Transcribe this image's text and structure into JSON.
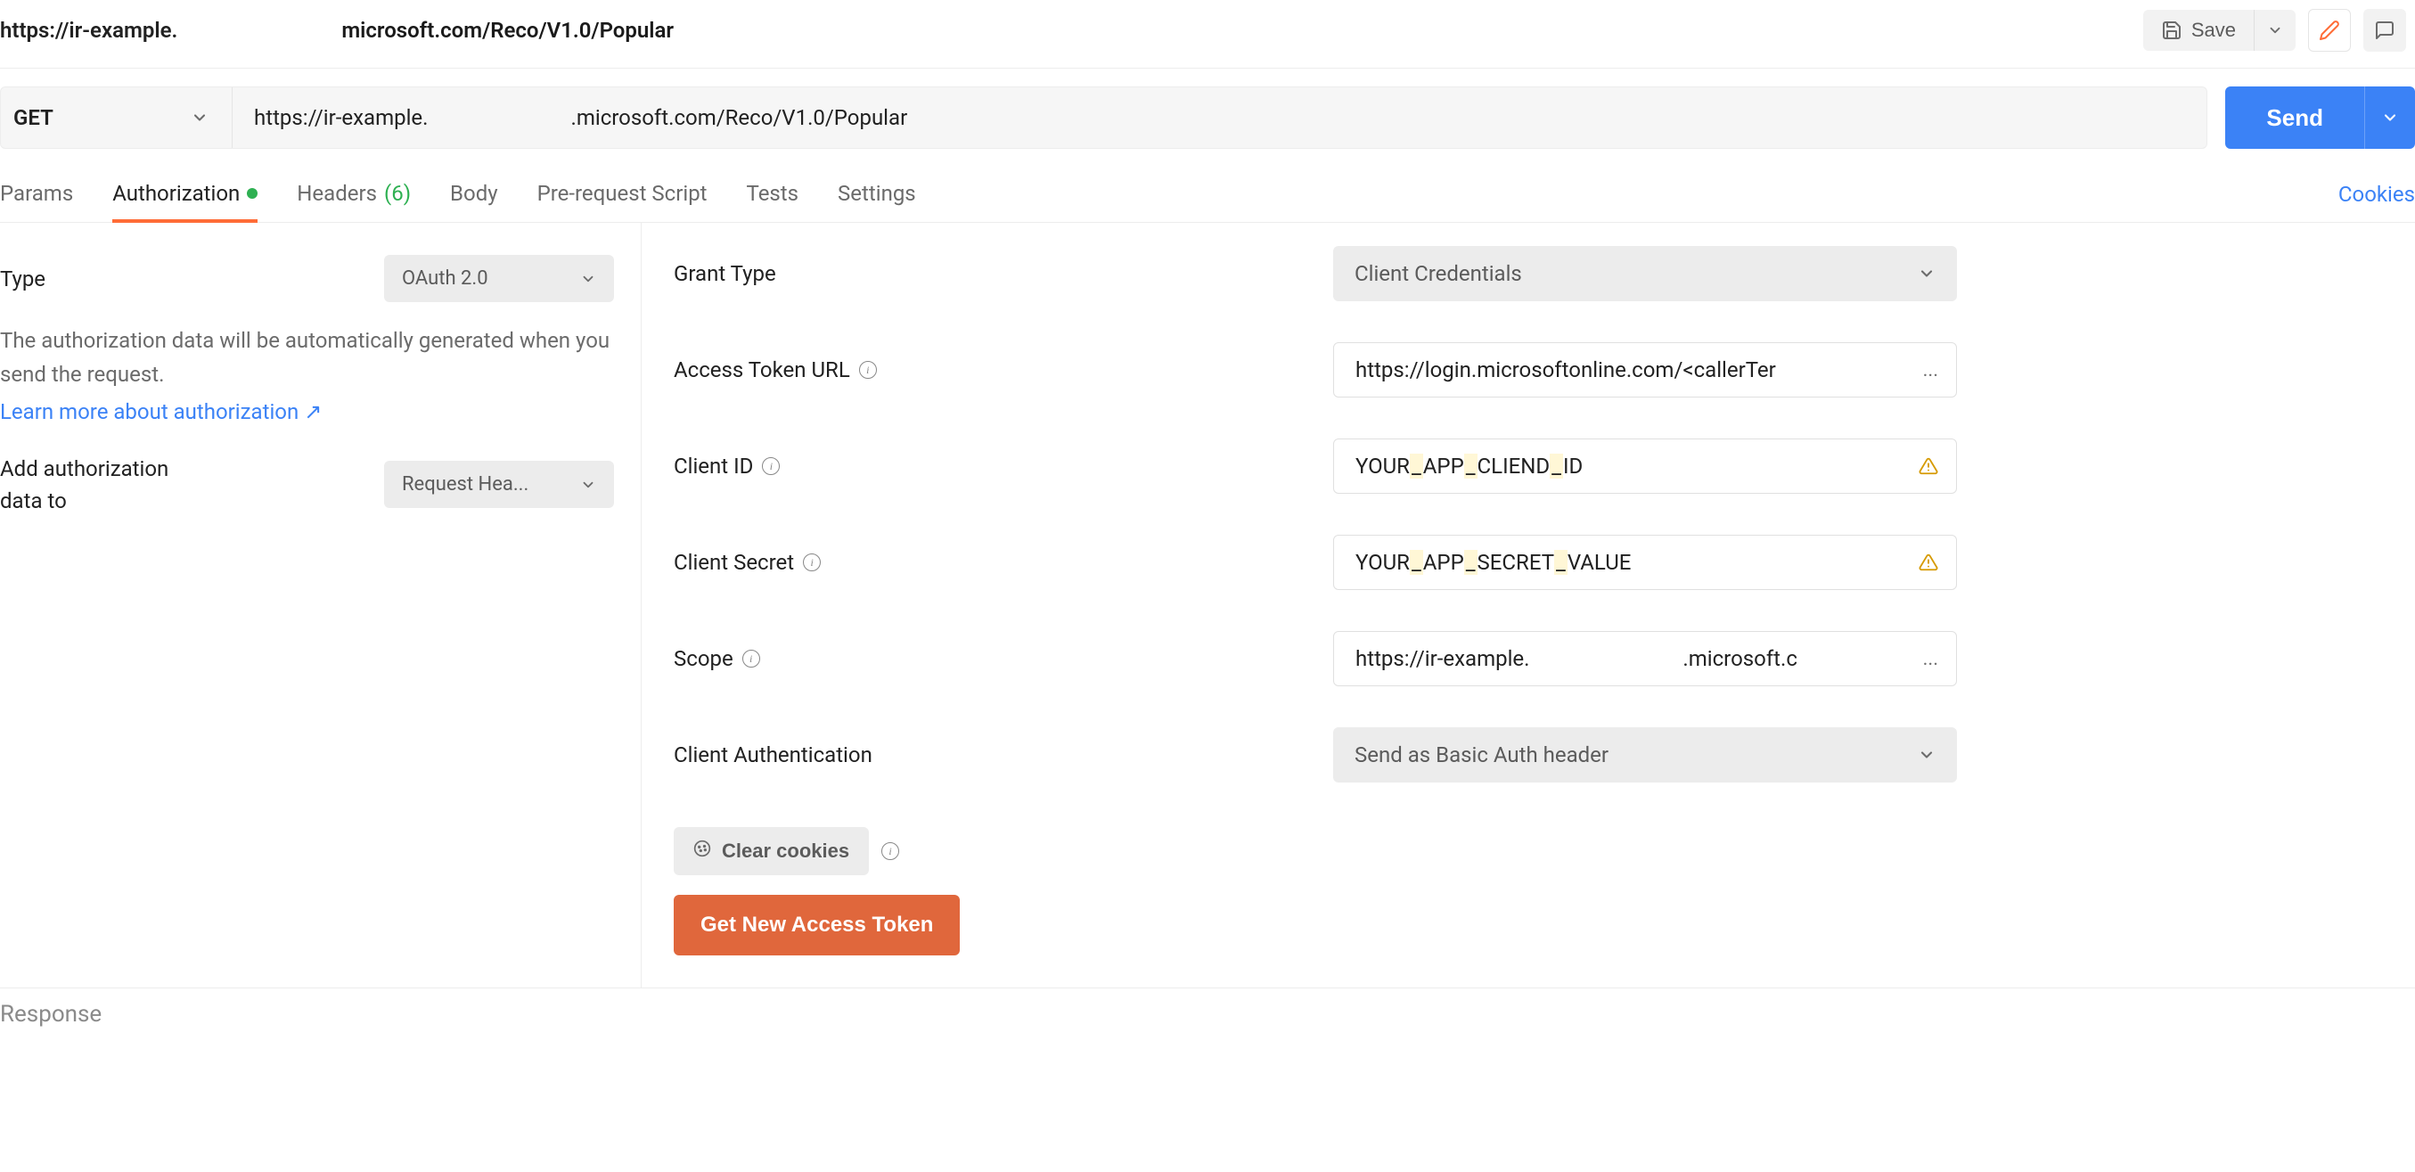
{
  "title": {
    "part1": "https://ir-example.",
    "part2": "microsoft.com/Reco/V1.0/Popular"
  },
  "save_label": "Save",
  "request": {
    "method": "GET",
    "url_part1": "https://ir-example.",
    "url_part2": ".microsoft.com/Reco/V1.0/Popular",
    "send_label": "Send"
  },
  "tabs": {
    "params": "Params",
    "authorization": "Authorization",
    "headers": "Headers",
    "headers_count": "(6)",
    "body": "Body",
    "prerequest": "Pre-request Script",
    "tests": "Tests",
    "settings": "Settings"
  },
  "cookies_label": "Cookies",
  "left": {
    "type_label": "Type",
    "type_value": "OAuth 2.0",
    "help_line": "The authorization data will be automatically generated when you send the request.",
    "learn_more": "Learn more about authorization",
    "add_auth_label_l1": "Add authorization",
    "add_auth_label_l2": "data to",
    "add_auth_value": "Request Hea..."
  },
  "form": {
    "grant_type_label": "Grant Type",
    "grant_type_value": "Client Credentials",
    "access_token_label": "Access Token URL",
    "access_token_value": "https://login.microsoftonline.com/<callerTer",
    "access_token_ellipsis": "...",
    "client_id_label": "Client ID",
    "client_id_value": {
      "p1": "YOUR",
      "p2": "APP",
      "p3": "CLIEND",
      "p4": "ID"
    },
    "client_secret_label": "Client Secret",
    "client_secret_value": {
      "p1": "YOUR",
      "p2": "APP",
      "p3": "SECRET",
      "p4": "VALUE"
    },
    "scope_label": "Scope",
    "scope_value_p1": "https://ir-example.",
    "scope_value_p2": ".microsoft.c",
    "scope_ellipsis": "...",
    "client_auth_label": "Client Authentication",
    "client_auth_value": "Send as Basic Auth header"
  },
  "actions": {
    "clear_cookies": "Clear cookies",
    "get_token": "Get New Access Token"
  },
  "response_label": "Response"
}
